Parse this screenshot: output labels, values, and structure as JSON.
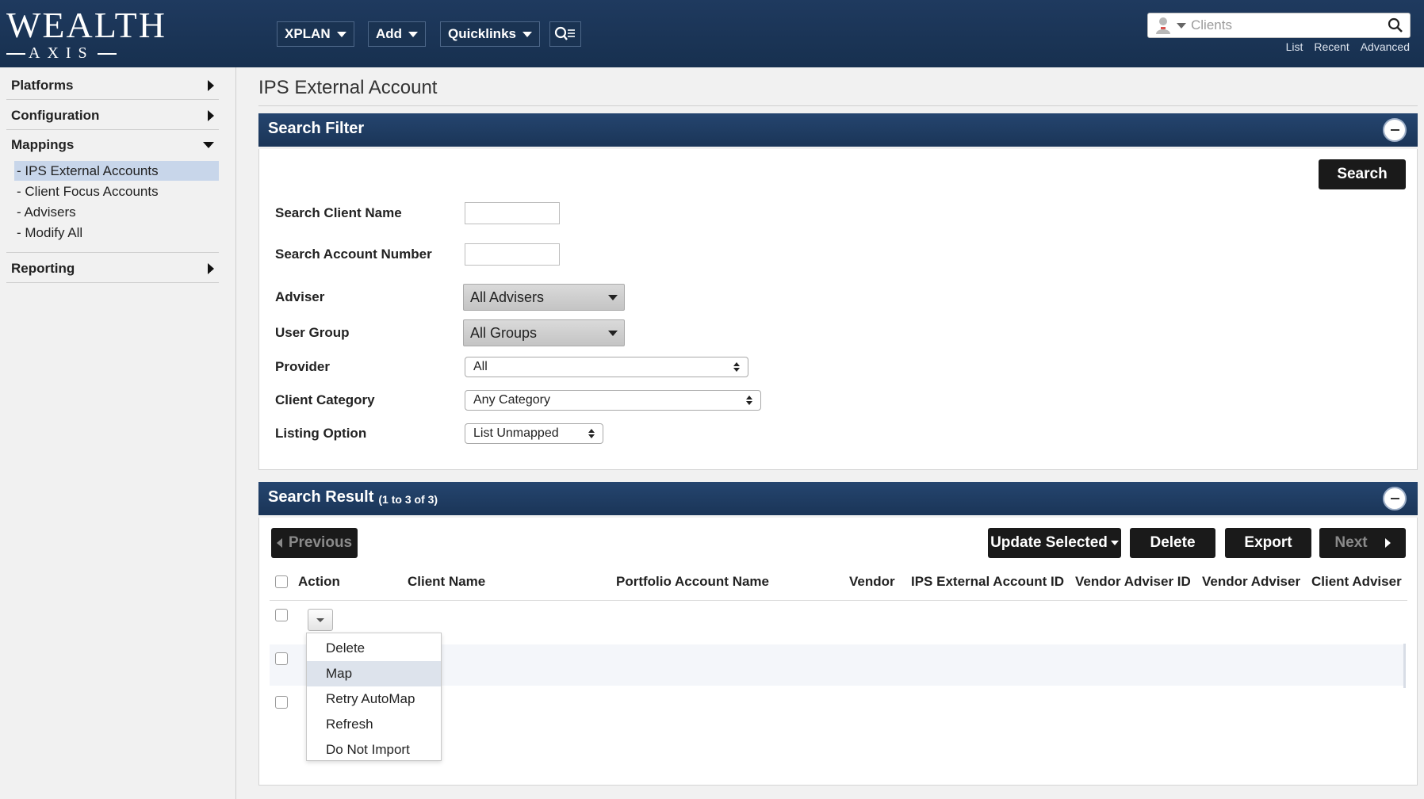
{
  "header": {
    "logo_top": "WEALTH",
    "logo_bottom": "AXIS",
    "nav": [
      {
        "label": "XPLAN"
      },
      {
        "label": "Add"
      },
      {
        "label": "Quicklinks"
      }
    ],
    "search_placeholder": "Clients",
    "links": [
      "List",
      "Recent",
      "Advanced"
    ]
  },
  "sidebar": {
    "sections": {
      "platforms": "Platforms",
      "configuration": "Configuration",
      "mappings": "Mappings",
      "reporting": "Reporting"
    },
    "mapping_items": [
      "- IPS External Accounts",
      "- Client Focus Accounts",
      "- Advisers",
      "- Modify All"
    ]
  },
  "page": {
    "title": "IPS External Account"
  },
  "filter": {
    "title": "Search Filter",
    "search_button": "Search",
    "labels": {
      "client_name": "Search Client Name",
      "account_number": "Search Account Number",
      "adviser": "Adviser",
      "user_group": "User Group",
      "provider": "Provider",
      "client_category": "Client Category",
      "listing_option": "Listing Option"
    },
    "values": {
      "client_name": "",
      "account_number": "",
      "adviser": "All Advisers",
      "user_group": "All Groups",
      "provider": "All",
      "client_category": "Any Category",
      "listing_option": "List Unmapped"
    }
  },
  "results": {
    "title": "Search Result",
    "count": "(1 to 3 of 3)",
    "previous": "Previous",
    "update_selected": "Update Selected",
    "delete": "Delete",
    "export": "Export",
    "next": "Next",
    "columns": [
      "Action",
      "Client Name",
      "Portfolio Account Name",
      "Vendor",
      "IPS External Account ID",
      "Vendor Adviser ID",
      "Vendor Adviser",
      "Client Adviser"
    ],
    "action_menu": [
      "Delete",
      "Map",
      "Retry AutoMap",
      "Refresh",
      "Do Not Import"
    ],
    "highlighted_menu_item": "Map"
  },
  "colors": {
    "header_bg": "#1f3a5f",
    "panel_header": "#25456f",
    "active_nav": "#c8d6ea",
    "dark_button": "#1a1a1a"
  }
}
